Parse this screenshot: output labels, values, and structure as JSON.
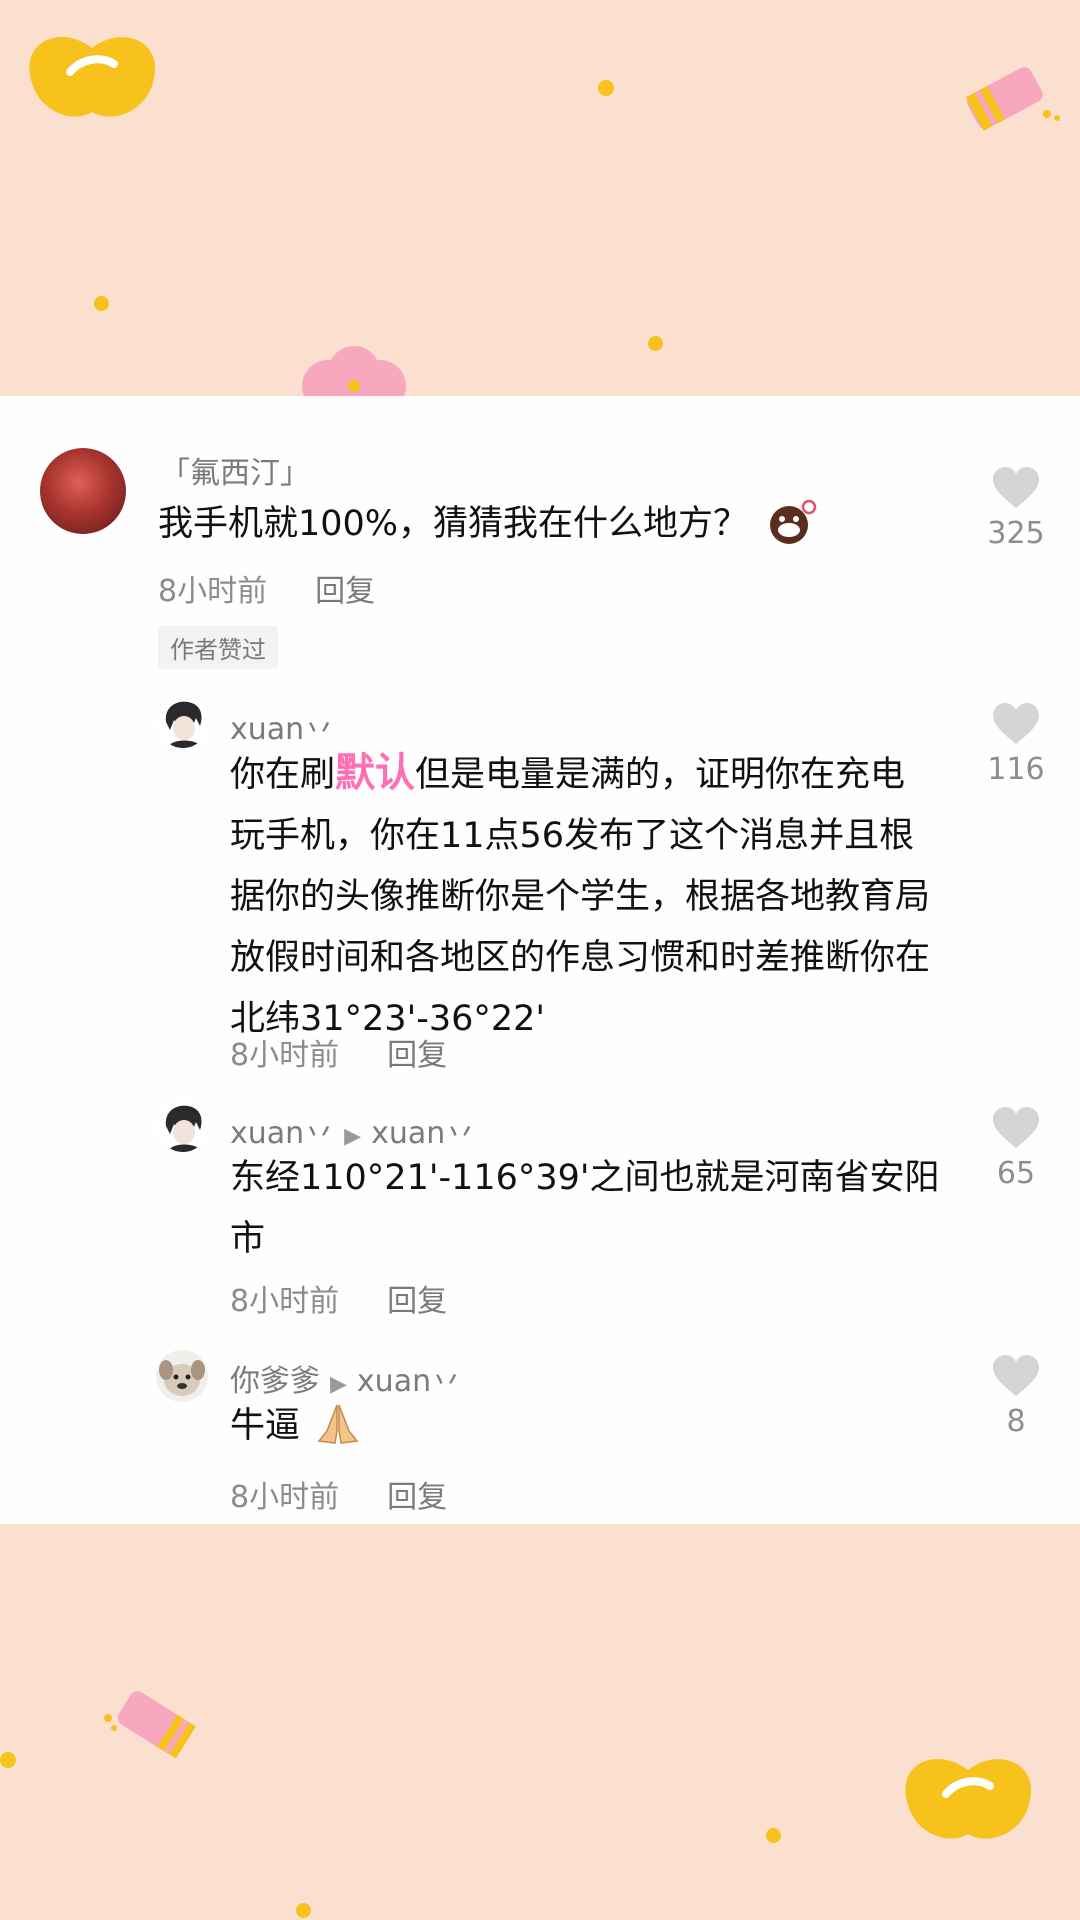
{
  "comments": [
    {
      "username": "「氟西汀」",
      "text": "我手机就100%，猜猜我在什么地方？",
      "time": "8小时前",
      "reply": "回复",
      "badge": "作者赞过",
      "likes": "325"
    },
    {
      "username": "xuan丷",
      "text_prefix": "你在刷",
      "highlight": "默认",
      "text_suffix": "但是电量是满的，证明你在充电玩手机，你在11点56发布了这个消息并且根据你的头像推断你是个学生，根据各地教育局放假时间和各地区的作息习惯和时差推断你在北纬31°23'-36°22'",
      "time": "8小时前",
      "reply": "回复",
      "likes": "116"
    },
    {
      "username": "xuan丷",
      "reply_to": "xuan丷",
      "text": "东经110°21'-116°39'之间也就是河南省安阳市",
      "time": "8小时前",
      "reply": "回复",
      "likes": "65"
    },
    {
      "username": "你爹爹",
      "reply_to": "xuan丷",
      "text": "牛逼",
      "time": "8小时前",
      "reply": "回复",
      "likes": "8"
    }
  ],
  "colors": {
    "background": "#fbe0cf",
    "panel": "#fefefe",
    "accent_yellow": "#f6c21b",
    "accent_pink": "#f7a8bf",
    "highlight_pink": "#ff6fb3"
  }
}
